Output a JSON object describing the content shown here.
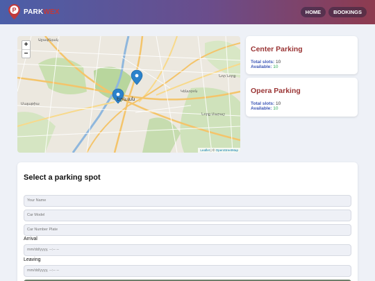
{
  "nav": {
    "brand_part1": "PARK",
    "brand_part2": "WEX",
    "home_label": "HOME",
    "bookings_label": "BOOKINGS"
  },
  "map": {
    "zoom_in": "+",
    "zoom_out": "−",
    "attribution_leaflet": "Leaflet",
    "attribution_sep": " | © ",
    "attribution_osm": "OpenStreetMap",
    "labels": {
      "city": "Երևան",
      "district_top": "Աջափնյակ",
      "district_right": "Նոր Նորք",
      "district_center": "Կենտրոն",
      "district_east": "Նորք Մարաշ",
      "district_left": "Մալաթիա"
    }
  },
  "parkings": [
    {
      "name": "Center Parking",
      "total_label": "Total slots:",
      "total_value": "10",
      "available_label": "Available:",
      "available_value": "10"
    },
    {
      "name": "Opera Parking",
      "total_label": "Total slots:",
      "total_value": "10",
      "available_label": "Available:",
      "available_value": "10"
    }
  ],
  "form": {
    "title": "Select a parking spot",
    "name_placeholder": "Your Name",
    "model_placeholder": "Car Model",
    "plate_placeholder": "Car Number Plate",
    "arrival_label": "Arrival",
    "arrival_value": "mm/dd/yyyy, --:-- --",
    "leaving_label": "Leaving",
    "leaving_value": "mm/dd/yyyy, --:-- --"
  }
}
